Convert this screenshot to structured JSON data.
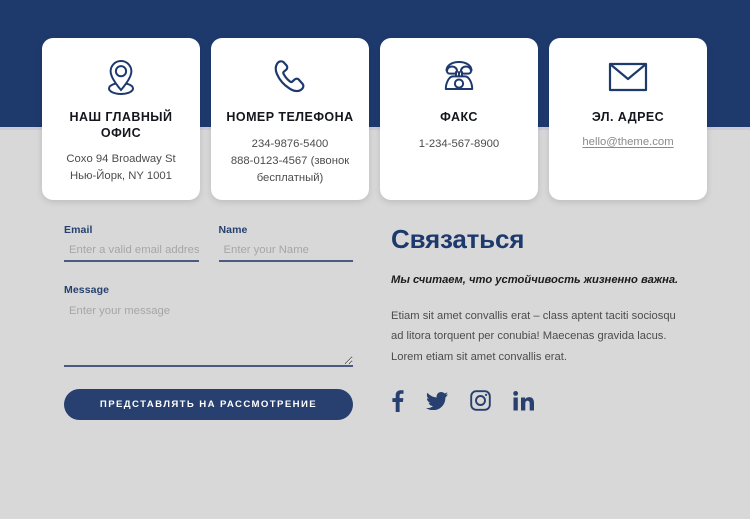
{
  "theme": {
    "navy": "#1e3a6d",
    "button_navy": "#27406f",
    "page_background": "#d8d8d8",
    "card_background": "#ffffff",
    "label_blue": "#26416e",
    "body_text": "#4c4c4c",
    "link_gray": "#8a8a8a"
  },
  "banner": {
    "present": true
  },
  "cards": [
    {
      "icon": "map-pin-icon",
      "title": "НАШ ГЛАВНЫЙ ОФИС",
      "lines": [
        "Coxo 94 Broadway St Нью-Йорк, NY 1001"
      ],
      "link": null
    },
    {
      "icon": "phone-handset-icon",
      "title": "НОМЕР ТЕЛЕФОНА",
      "lines": [
        "234-9876-5400",
        "888-0123-4567 (звонок бесплатный)"
      ],
      "link": null
    },
    {
      "icon": "fax-machine-icon",
      "title": "ФАКС",
      "lines": [
        "1-234-567-8900"
      ],
      "link": null
    },
    {
      "icon": "envelope-icon",
      "title": "ЭЛ. АДРЕС",
      "lines": [],
      "link": "hello@theme.com"
    }
  ],
  "form": {
    "email": {
      "label": "Email",
      "placeholder": "Enter a valid email address",
      "value": ""
    },
    "name": {
      "label": "Name",
      "placeholder": "Enter your Name",
      "value": ""
    },
    "message": {
      "label": "Message",
      "placeholder": "Enter your message",
      "value": ""
    },
    "submit_label": "ПРЕДСТАВЛЯТЬ НА РАССМОТРЕНИЕ"
  },
  "info": {
    "title": "Связаться",
    "lead": "Мы считаем, что устойчивость жизненно важна.",
    "body": "Etiam sit amet convallis erat – class aptent taciti sociosqu ad litora torquent per conubia! Maecenas gravida lacus. Lorem etiam sit amet convallis erat.",
    "socials": [
      {
        "name": "facebook",
        "label": "f"
      },
      {
        "name": "twitter",
        "label": "t"
      },
      {
        "name": "instagram",
        "label": "ig"
      },
      {
        "name": "linkedin",
        "label": "in"
      }
    ]
  }
}
